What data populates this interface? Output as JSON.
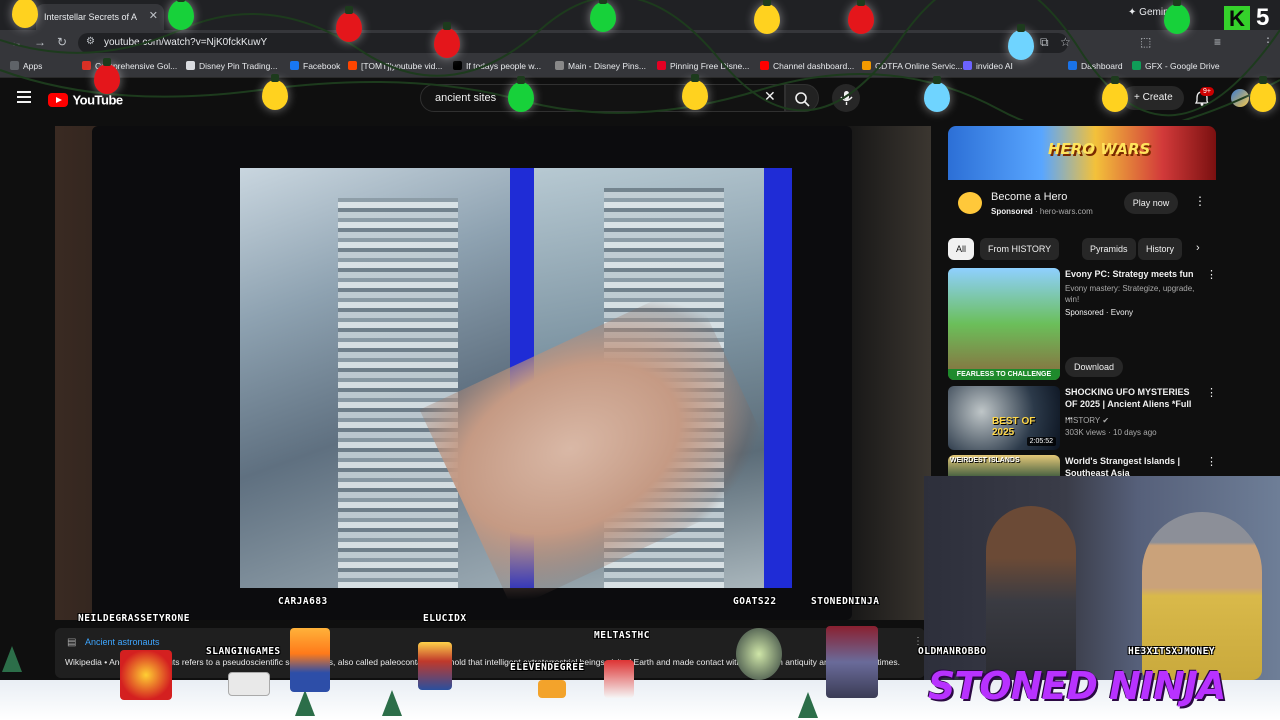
{
  "browser": {
    "tab_title": "Interstellar Secrets of A",
    "tab_close": "✕",
    "gemini_label": "Gemini",
    "url": "youtube.com/watch?v=NjK0fckKuwY",
    "bookmarks": [
      {
        "label": "Apps",
        "color": "#5f6368"
      },
      {
        "label": "Comprehensive Gol...",
        "color": "#d93025"
      },
      {
        "label": "Disney Pin Trading...",
        "color": "#dadce0"
      },
      {
        "label": "Facebook",
        "color": "#1877f2"
      },
      {
        "label": "[TOMT]|youtube vid...",
        "color": "#ff4500"
      },
      {
        "label": "If todays people w...",
        "color": "#000000"
      },
      {
        "label": "Main - Disney Pins...",
        "color": "#888888"
      },
      {
        "label": "Pinning Free Disne...",
        "color": "#e60023"
      },
      {
        "label": "Channel dashboard...",
        "color": "#ff0000"
      },
      {
        "label": "CDTFA Online Servic...",
        "color": "#f29900"
      },
      {
        "label": "invideo AI",
        "color": "#6c63ff"
      },
      {
        "label": "Dashboard",
        "color": "#1a73e8"
      },
      {
        "label": "GFX - Google Drive",
        "color": "#0f9d58"
      }
    ]
  },
  "youtube": {
    "logo_text": "YouTube",
    "search_value": "ancient sites",
    "create_label": "Create",
    "notification_count": "9+"
  },
  "video_overlay": {
    "chat_names": [
      "NEILDEGRASSETYRONE",
      "CARJA683",
      "ELUCIDX",
      "GOATS22",
      "STONEDNINJA",
      "SLANGINGAMES",
      "MELTASTHC",
      "ELEVENDEGREE",
      "OLDMANROBBO"
    ]
  },
  "description": {
    "title": "Ancient astronauts",
    "source": "Wikipedia",
    "text": "Wikipedia • Ancient astronauts refers to a pseudoscientific set of beliefs, also called paleocontact, that hold that intelligent extraterrestrial beings visited Earth and made contact with humans in antiquity and prehistoric times."
  },
  "sidebar": {
    "ad": {
      "banner_text": "HERO WARS",
      "title": "Become a Hero",
      "sponsored": "Sponsored",
      "domain": "hero-wars.com",
      "cta": "Play now"
    },
    "chips": [
      {
        "label": "All",
        "active": true
      },
      {
        "label": "From HISTORY",
        "active": false
      },
      {
        "label": "Pyramids",
        "active": false
      },
      {
        "label": "History",
        "active": false
      }
    ],
    "recommendations": [
      {
        "title": "Evony PC: Strategy meets fun",
        "meta1": "Evony mastery: Strategize, upgrade, win!",
        "meta2": "Sponsored · Evony",
        "cta": "Download",
        "thumb_text": "FEARLESS TO CHALLENGE"
      },
      {
        "title": "SHOCKING UFO MYSTERIES OF 2025 | Ancient Aliens *Full ...",
        "meta1": "HISTORY ✔",
        "meta2": "303K views · 10 days ago",
        "duration": "2:05:52",
        "thumb_text": "BEST OF 2025"
      },
      {
        "title": "World's Strangest Islands | Southeast Asia",
        "meta1": "",
        "meta2": "",
        "thumb_text": "WEIRDEST ISLANDS"
      }
    ]
  },
  "stream": {
    "brand": "STONED NINJA",
    "cam_name_left": "OLDMANROBBO",
    "cam_name_right": "HE3XITSXJMONEY",
    "corner_logo": "K",
    "corner_number": "5"
  }
}
